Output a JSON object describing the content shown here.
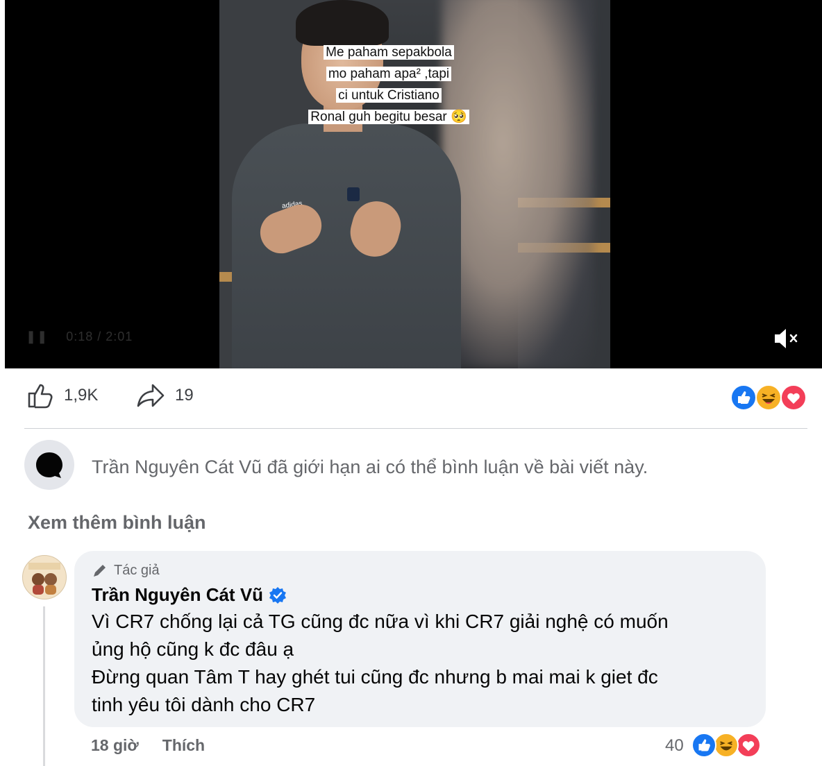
{
  "video": {
    "caption_lines": [
      "Me          paham sepakbola",
      "mo         paham apa² ,tapi",
      "ci           untuk Cristiano",
      "Ronal     guh begitu besar 🥺"
    ],
    "shirt_brand": "adidas",
    "time_display": "0:18 / 2:01"
  },
  "actions": {
    "like_count": "1,9K",
    "share_count": "19"
  },
  "reactions": {
    "like_color": "#1877f2",
    "haha_color": "#f7b125",
    "love_color": "#f33e58"
  },
  "notice": {
    "text": "Trần Nguyên Cát Vũ đã giới hạn ai có thể bình luận về bài viết này."
  },
  "more_comments_label": "Xem thêm bình luận",
  "comment": {
    "badge": "Tác giả",
    "author": "Trần Nguyên Cát Vũ",
    "lines": [
      "Vì CR7 chống lại cả TG cũng đc nữa vì khi CR7 giải nghệ có muốn",
      "ủng hộ cũng k đc đâu ạ",
      "Đừng quan Tâm T hay ghét tui cũng đc nhưng b mai mai k giet đc",
      "tinh yêu tôi dành cho CR7"
    ],
    "time": "18 giờ",
    "like_label": "Thích",
    "reaction_count": "40"
  },
  "colors": {
    "accent": "#1877f2",
    "secondary_text": "#65676b"
  }
}
